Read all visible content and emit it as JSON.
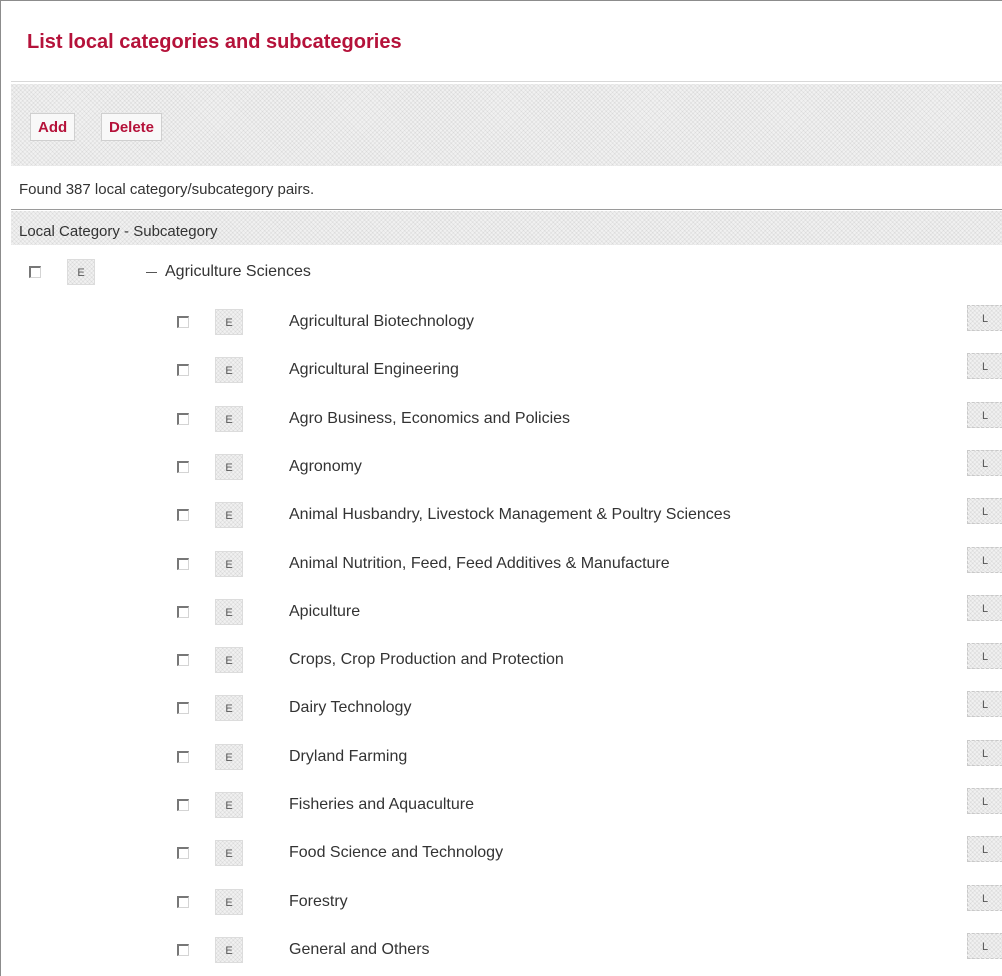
{
  "page": {
    "title": "List local categories and subcategories"
  },
  "toolbar": {
    "add_label": "Add",
    "delete_label": "Delete"
  },
  "summary": {
    "found_text": "Found 387 local category/subcategory pairs."
  },
  "table": {
    "column_header": "Local Category - Subcategory",
    "edit_button_label": "E",
    "list_button_label": "L",
    "category": {
      "label": "Agriculture Sciences",
      "checked": false
    },
    "subcategories": [
      {
        "label": "Agricultural Biotechnology",
        "checked": false
      },
      {
        "label": "Agricultural Engineering",
        "checked": false
      },
      {
        "label": "Agro Business, Economics and Policies",
        "checked": false
      },
      {
        "label": "Agronomy",
        "checked": false
      },
      {
        "label": "Animal Husbandry, Livestock Management & Poultry Sciences",
        "checked": false
      },
      {
        "label": "Animal Nutrition, Feed, Feed Additives & Manufacture",
        "checked": false
      },
      {
        "label": "Apiculture",
        "checked": false
      },
      {
        "label": "Crops, Crop Production and Protection",
        "checked": false
      },
      {
        "label": "Dairy Technology",
        "checked": false
      },
      {
        "label": "Dryland Farming",
        "checked": false
      },
      {
        "label": "Fisheries and Aquaculture",
        "checked": false
      },
      {
        "label": "Food Science and Technology",
        "checked": false
      },
      {
        "label": "Forestry",
        "checked": false
      },
      {
        "label": "General and Others",
        "checked": false
      }
    ]
  },
  "colors": {
    "accent": "#b5123a",
    "text": "#333333"
  }
}
